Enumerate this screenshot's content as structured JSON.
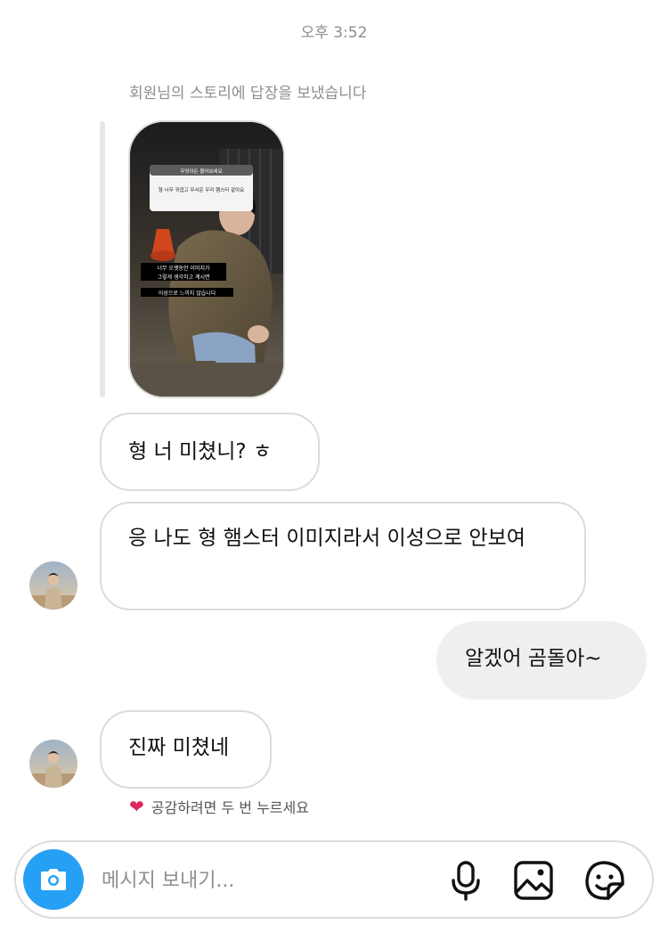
{
  "header": {
    "timestamp": "오후 3:52"
  },
  "story_reply": {
    "note": "회원님의 스토리에 답장을 보냈습니다",
    "card": {
      "question_header": "무엇이든 물어보세요",
      "question_text": "형 너무 귀엽고 무서운 우리 햄스터 같아요",
      "caption_lines": [
        "너무 오랫동안 이미지가",
        "그렇게 생각하고 계시면",
        "이성으로 느끼지 않습니다"
      ]
    }
  },
  "messages": [
    {
      "side": "in",
      "text": "형 너 미쳤니? ㅎ"
    },
    {
      "side": "in",
      "text": "응 나도 형 햄스터 이미지라서 이성으로 안보여"
    },
    {
      "side": "out",
      "text": "알겠어 곰돌아~"
    },
    {
      "side": "in",
      "text": "진짜 미쳤네"
    }
  ],
  "like_hint": {
    "icon": "heart-icon",
    "text": "공감하려면 두 번 누르세요"
  },
  "composer": {
    "placeholder": "메시지 보내기...",
    "value": "",
    "icons": [
      "camera-icon",
      "microphone-icon",
      "gallery-icon",
      "sticker-icon"
    ]
  },
  "colors": {
    "accent": "#26a0f5",
    "heart": "#e0245e",
    "muted": "#8e8e8e"
  }
}
